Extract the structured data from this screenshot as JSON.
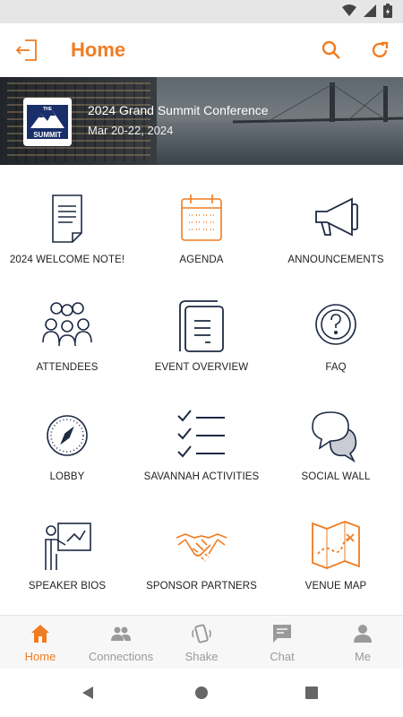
{
  "appbar": {
    "title": "Home"
  },
  "event": {
    "title": "2024 Grand Summit Conference",
    "dates": "Mar 20-22, 2024",
    "logo_text": "THE SUMMIT"
  },
  "tiles": [
    {
      "label": "2024 WELCOME NOTE!",
      "icon": "note-icon"
    },
    {
      "label": "AGENDA",
      "icon": "calendar-icon"
    },
    {
      "label": "ANNOUNCEMENTS",
      "icon": "megaphone-icon"
    },
    {
      "label": "ATTENDEES",
      "icon": "people-icon"
    },
    {
      "label": "EVENT OVERVIEW",
      "icon": "document-icon"
    },
    {
      "label": "FAQ",
      "icon": "question-icon"
    },
    {
      "label": "LOBBY",
      "icon": "compass-icon"
    },
    {
      "label": "SAVANNAH ACTIVITIES",
      "icon": "checklist-icon"
    },
    {
      "label": "SOCIAL WALL",
      "icon": "chat-bubbles-icon"
    },
    {
      "label": "SPEAKER BIOS",
      "icon": "presenter-icon"
    },
    {
      "label": "SPONSOR PARTNERS",
      "icon": "handshake-icon"
    },
    {
      "label": "VENUE MAP",
      "icon": "map-icon"
    }
  ],
  "bottom_nav": [
    {
      "label": "Home",
      "active": true
    },
    {
      "label": "Connections",
      "active": false
    },
    {
      "label": "Shake",
      "active": false
    },
    {
      "label": "Chat",
      "active": false
    },
    {
      "label": "Me",
      "active": false
    }
  ],
  "colors": {
    "accent": "#f07c22",
    "icon_navy": "#1d2a44",
    "muted": "#9a9a9a"
  }
}
